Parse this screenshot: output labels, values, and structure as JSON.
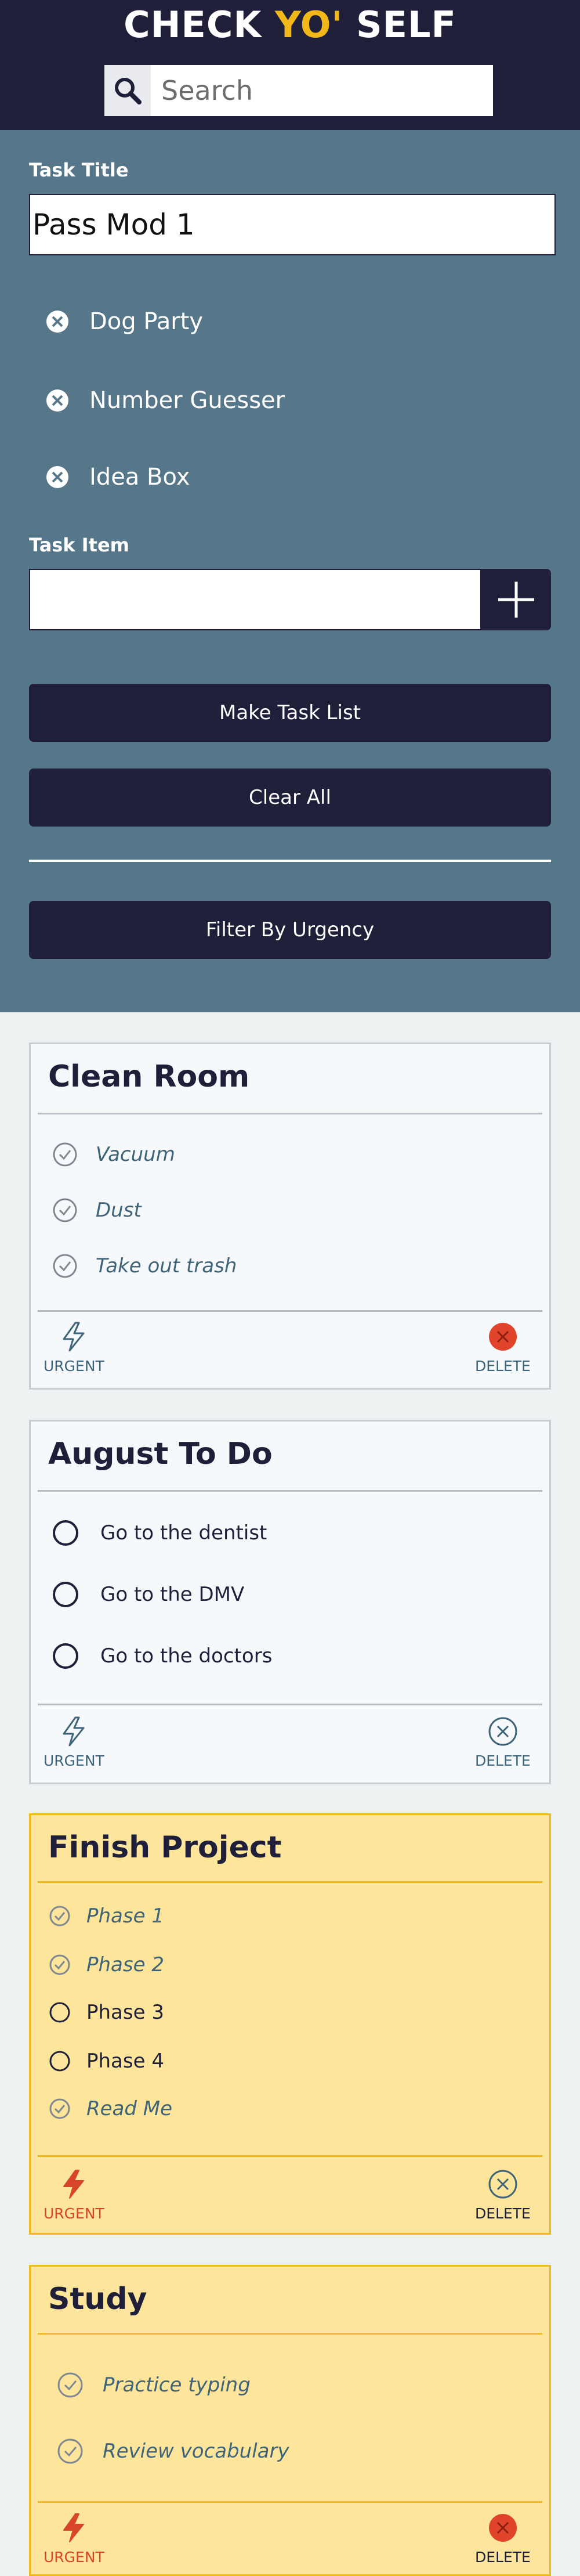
{
  "header": {
    "brand_part1": "CHECK",
    "brand_part2": "YO'",
    "brand_part3": "SELF",
    "search_placeholder": "Search",
    "search_value": ""
  },
  "form": {
    "task_title_label": "Task Title",
    "task_title_value": "Pass Mod 1",
    "draft_items": [
      "Dog Party",
      "Number Guesser",
      "Idea Box"
    ],
    "task_item_label": "Task Item",
    "task_item_value": "",
    "make_list_label": "Make Task List",
    "clear_all_label": "Clear All",
    "filter_label": "Filter By Urgency"
  },
  "cards": [
    {
      "title": "Clean Room",
      "urgent": false,
      "tasks": [
        {
          "text": "Vacuum",
          "done": true
        },
        {
          "text": "Dust",
          "done": true
        },
        {
          "text": "Take out trash",
          "done": true
        }
      ],
      "urgent_label": "URGENT",
      "delete_label": "DELETE"
    },
    {
      "title": "August To Do",
      "urgent": false,
      "tasks": [
        {
          "text": "Go to the dentist",
          "done": false
        },
        {
          "text": "Go to the DMV",
          "done": false
        },
        {
          "text": "Go to the doctors",
          "done": false
        }
      ],
      "urgent_label": "URGENT",
      "delete_label": "DELETE"
    },
    {
      "title": "Finish Project",
      "urgent": true,
      "tasks": [
        {
          "text": "Phase 1",
          "done": true
        },
        {
          "text": "Phase 2",
          "done": true
        },
        {
          "text": "Phase 3",
          "done": false
        },
        {
          "text": "Phase 4",
          "done": false
        },
        {
          "text": "Read Me",
          "done": true
        }
      ],
      "urgent_label": "URGENT",
      "delete_label": "DELETE"
    },
    {
      "title": "Study",
      "urgent": true,
      "tasks": [
        {
          "text": "Practice typing",
          "done": true
        },
        {
          "text": "Review vocabulary",
          "done": true
        }
      ],
      "urgent_label": "URGENT",
      "delete_label": "DELETE"
    }
  ],
  "colors": {
    "navy": "#1f1f3a",
    "slate": "#56768a",
    "yellow": "#f2b81a",
    "urgent_card": "#fde59c",
    "delete_red": "#e0452c"
  }
}
